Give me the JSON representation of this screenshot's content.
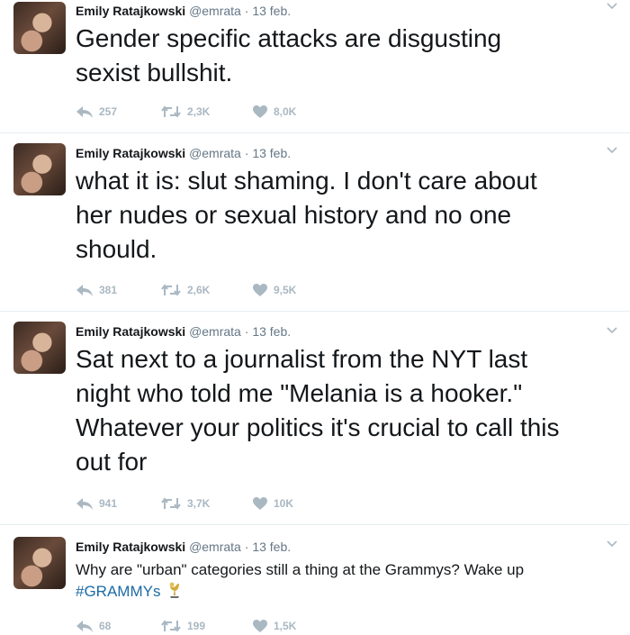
{
  "author": {
    "name": "Emily Ratajkowski",
    "handle": "@emrata"
  },
  "sep": "·",
  "tweets": [
    {
      "date": "13 feb.",
      "lines": [
        "Gender specific attacks are disgusting",
        "sexist bullshit."
      ],
      "reply": "257",
      "retweet": "2,3K",
      "like": "8,0K"
    },
    {
      "date": "13 feb.",
      "lines": [
        "what it is: slut shaming. I don't care about",
        "her nudes or sexual history and no one",
        "should."
      ],
      "reply": "381",
      "retweet": "2,6K",
      "like": "9,5K"
    },
    {
      "date": "13 feb.",
      "lines": [
        "Sat next to a journalist from the NYT last",
        "night who told me \"Melania is a hooker.\"",
        "Whatever your politics it's crucial to call this",
        "out for"
      ],
      "reply": "941",
      "retweet": "3,7K",
      "like": "10K"
    },
    {
      "date": "13 feb.",
      "lines": [
        "Why are \"urban\" categories still a thing at the Grammys? Wake up"
      ],
      "hashtag": "#GRAMMYs",
      "reply": "68",
      "retweet": "199",
      "like": "1,5K"
    }
  ],
  "icons": {
    "reply": "reply-icon",
    "retweet": "retweet-icon",
    "like": "heart-icon",
    "more": "chevron-down-icon",
    "grammy": "grammy-trophy-icon"
  },
  "colors": {
    "text": "#14171a",
    "meta": "#657786",
    "action": "#aab8c2",
    "hashtag": "#1b6aa5",
    "divider": "#e6ecf0"
  }
}
